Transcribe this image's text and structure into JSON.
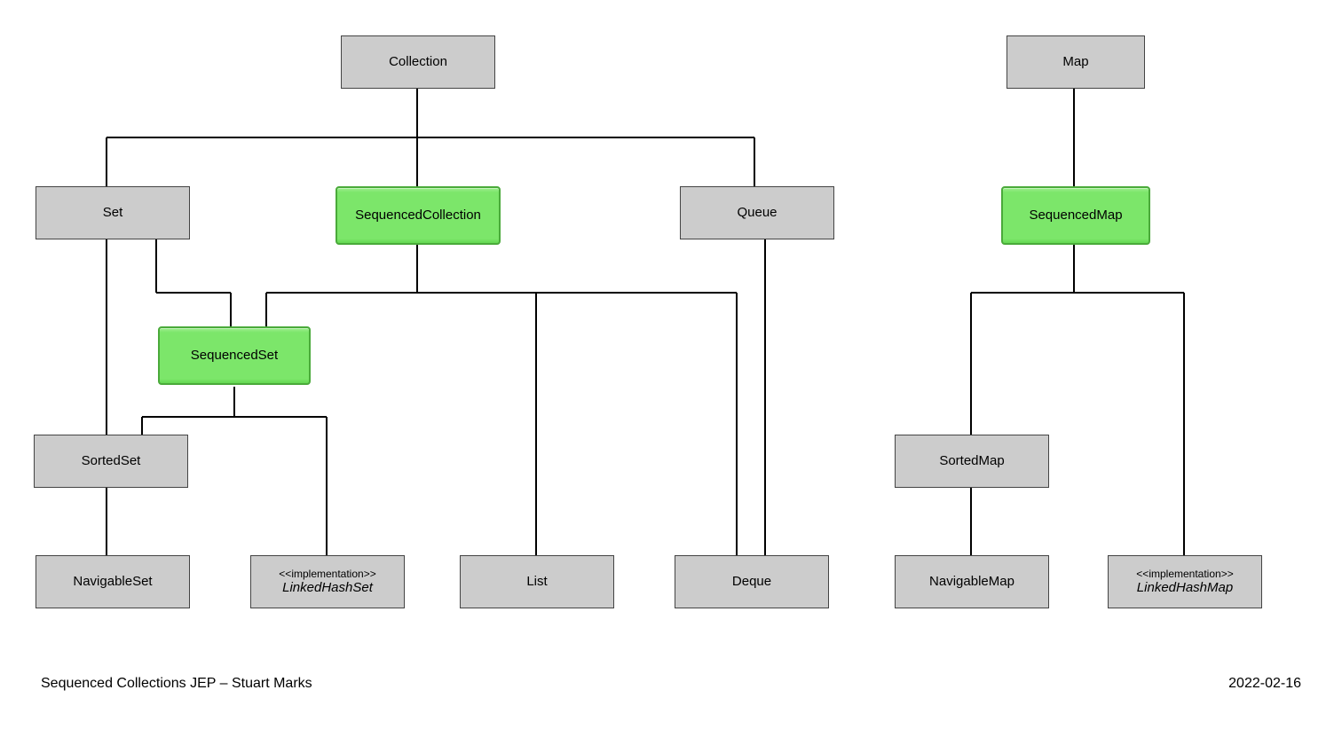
{
  "nodes": {
    "collection": "Collection",
    "set": "Set",
    "sequencedCollection": "SequencedCollection",
    "queue": "Queue",
    "sequencedSet": "SequencedSet",
    "sortedSet": "SortedSet",
    "navigableSet": "NavigableSet",
    "linkedHashSet_stereo": "<<implementation>>",
    "linkedHashSet_name": "LinkedHashSet",
    "list": "List",
    "deque": "Deque",
    "map": "Map",
    "sequencedMap": "SequencedMap",
    "sortedMap": "SortedMap",
    "navigableMap": "NavigableMap",
    "linkedHashMap_stereo": "<<implementation>>",
    "linkedHashMap_name": "LinkedHashMap"
  },
  "footer": {
    "left": "Sequenced Collections JEP – Stuart Marks",
    "right": "2022-02-16"
  }
}
